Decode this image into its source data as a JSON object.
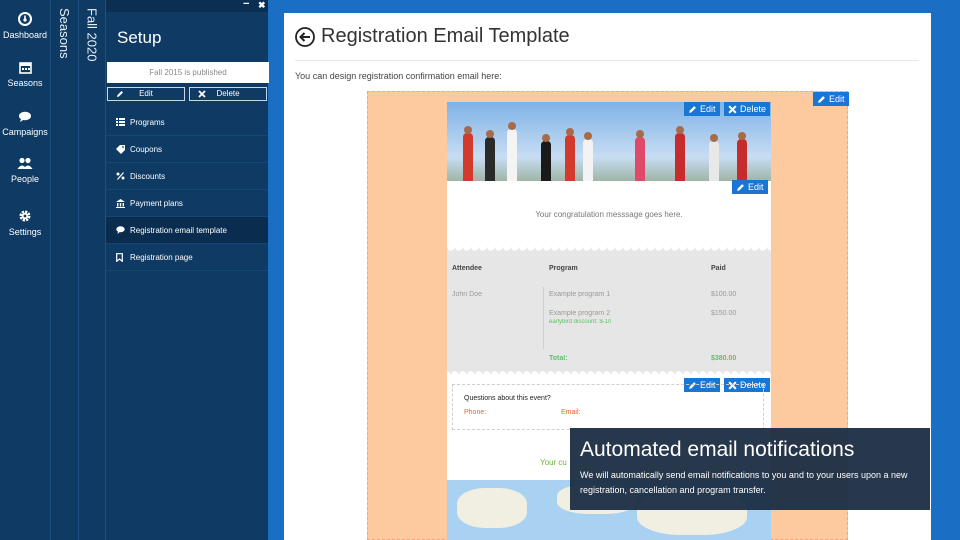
{
  "nav": [
    {
      "label": "Dashboard",
      "icon": "dashboard-icon"
    },
    {
      "label": "Seasons",
      "icon": "calendar-icon"
    },
    {
      "label": "Campaigns",
      "icon": "chat-icon"
    },
    {
      "label": "People",
      "icon": "people-icon"
    },
    {
      "label": "Settings",
      "icon": "gear-icon"
    }
  ],
  "breadcrumb": {
    "seasons": "Seasons",
    "season": "Fall 2020"
  },
  "setup": {
    "title": "Setup",
    "window_controls": {
      "minimize": "−",
      "close": "✖"
    },
    "published_text": "Fall 2015 is published",
    "edit_label": "Edit",
    "delete_label": "Delete",
    "menu": [
      {
        "label": "Programs",
        "icon": "list-icon"
      },
      {
        "label": "Coupons",
        "icon": "tag-icon"
      },
      {
        "label": "Discounts",
        "icon": "percent-icon"
      },
      {
        "label": "Payment plans",
        "icon": "bank-icon"
      },
      {
        "label": "Registration email template",
        "icon": "chat-icon"
      },
      {
        "label": "Registration page",
        "icon": "bookmark-icon"
      }
    ]
  },
  "main": {
    "title": "Registration Email Template",
    "intro": "You can design registration confirmation email here:"
  },
  "email": {
    "edit_label": "Edit",
    "delete_label": "Delete",
    "congrats": "Your congratulation messsage goes here.",
    "table": {
      "headers": {
        "attendee": "Attendee",
        "program": "Program",
        "paid": "Paid"
      },
      "attendee": "John Doe",
      "rows": [
        {
          "program": "Example program 1",
          "paid": "$100.00"
        },
        {
          "program": "Example program 2",
          "paid": "$150.00"
        }
      ],
      "discount": "earlybird discount: $-10",
      "total_label": "Total:",
      "total_value": "$380.00"
    },
    "questions": {
      "title": "Questions about this event?",
      "phone": "Phone:",
      "email": "Email:"
    },
    "partial_text": "Your cu"
  },
  "tooltip": {
    "title": "Automated email notifications",
    "body": "We will automatically send email notifications to you and to your users upon a new registration, cancellation and program transfer."
  },
  "colors": {
    "nav_bg": "#0e3a63",
    "accent": "#1976d2",
    "canvas": "#fdcaa0",
    "background": "#1a6fc4"
  }
}
